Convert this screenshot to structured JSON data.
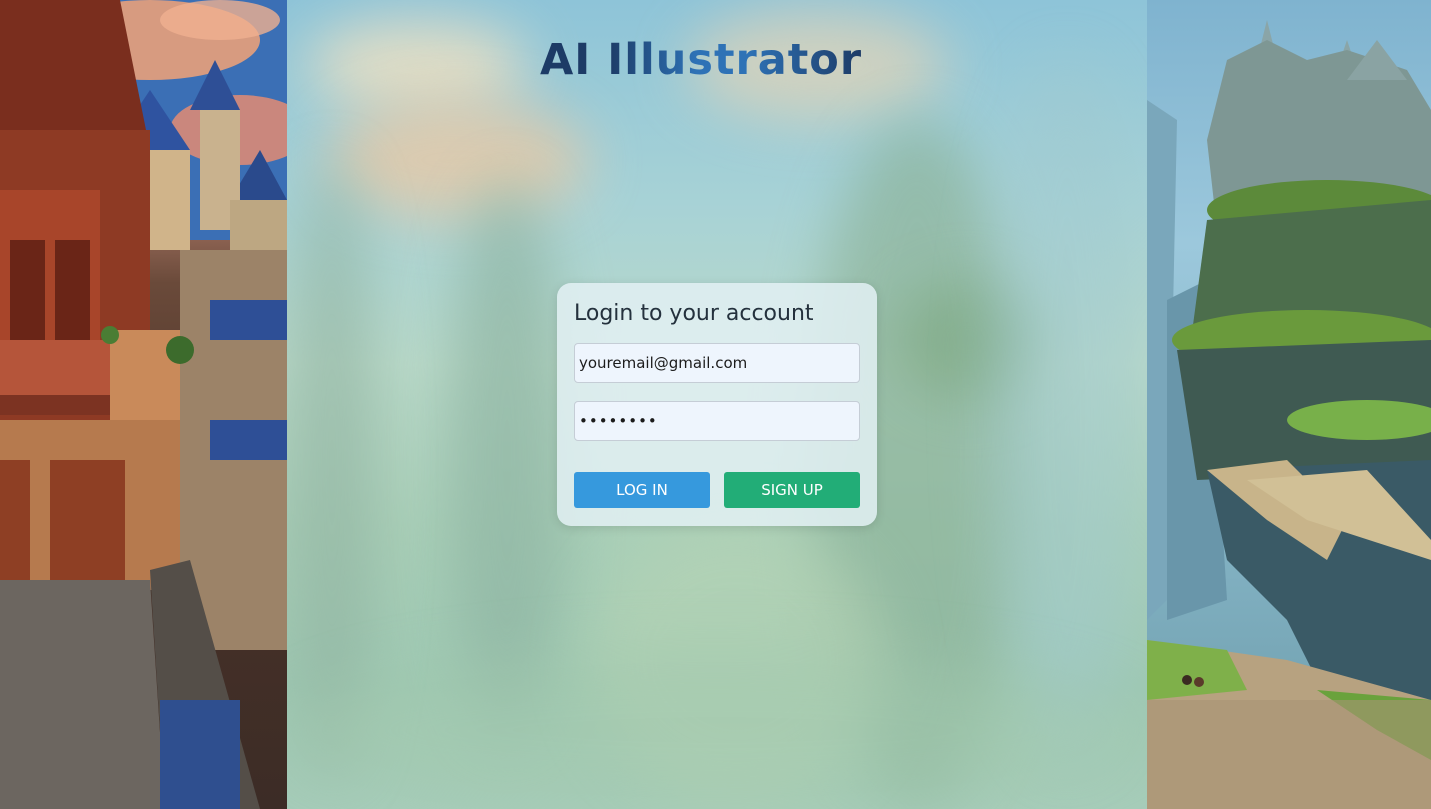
{
  "logo": {
    "part1": "AI",
    "part2": "Illustrator"
  },
  "login": {
    "title": "Login to your account",
    "email_value": "youremail@gmail.com",
    "password_value": "password",
    "login_label": "LOG IN",
    "signup_label": "SIGN UP"
  },
  "colors": {
    "login_button": "#3699dd",
    "signup_button": "#22ad77",
    "logo_dark": "#1d3b66",
    "logo_accent": "#2e72b6"
  }
}
